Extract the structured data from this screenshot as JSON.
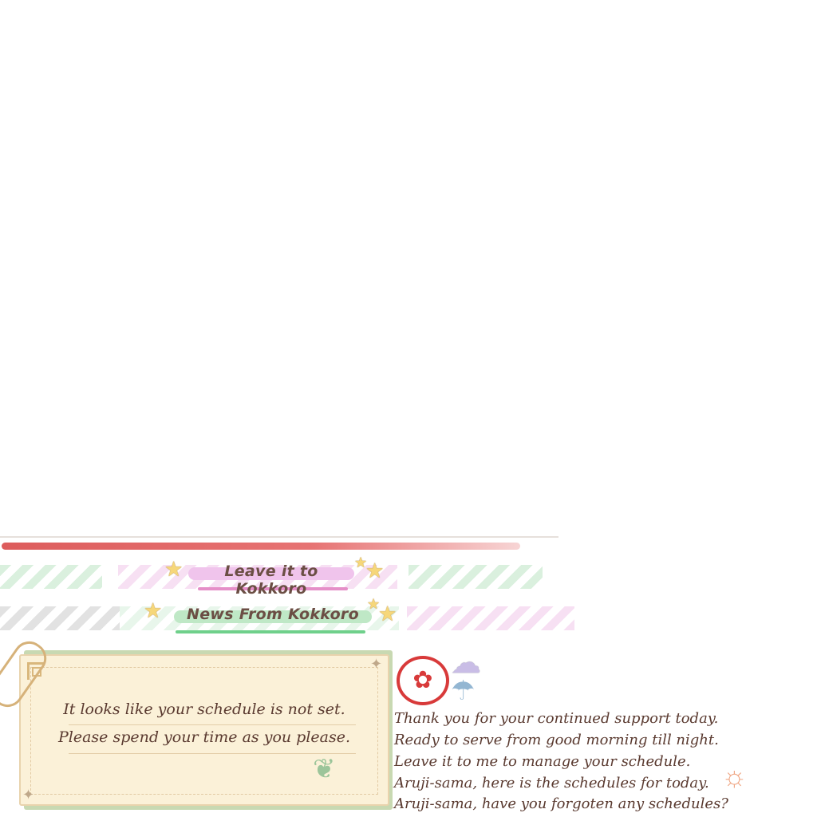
{
  "banners": {
    "leave": "Leave it to Kokkoro",
    "news": "News From Kokkoro"
  },
  "note_card": {
    "line1": "It looks like your schedule is not set.",
    "line2": "Please spend your time as you please."
  },
  "messages": [
    "Thank you for your continued support today.",
    "Ready to serve from good morning till night.",
    "Leave it to me to manage your schedule.",
    "Aruji-sama, here is the schedules for today.",
    "Aruji-sama, have you forgoten any schedules?"
  ],
  "icons": {
    "star": "★",
    "diamond": "✦",
    "stamp": "✿",
    "cloud": "☁",
    "umbrella": "☂",
    "sun": "☼",
    "critter": "❦"
  },
  "colors": {
    "text": "#5a3a30",
    "title": "#6b4e44",
    "red_stroke": "#d94a4a",
    "pink_highlight": "#f0c4ec",
    "green_highlight": "#bfe8c6",
    "card": "#fbf1d8"
  }
}
